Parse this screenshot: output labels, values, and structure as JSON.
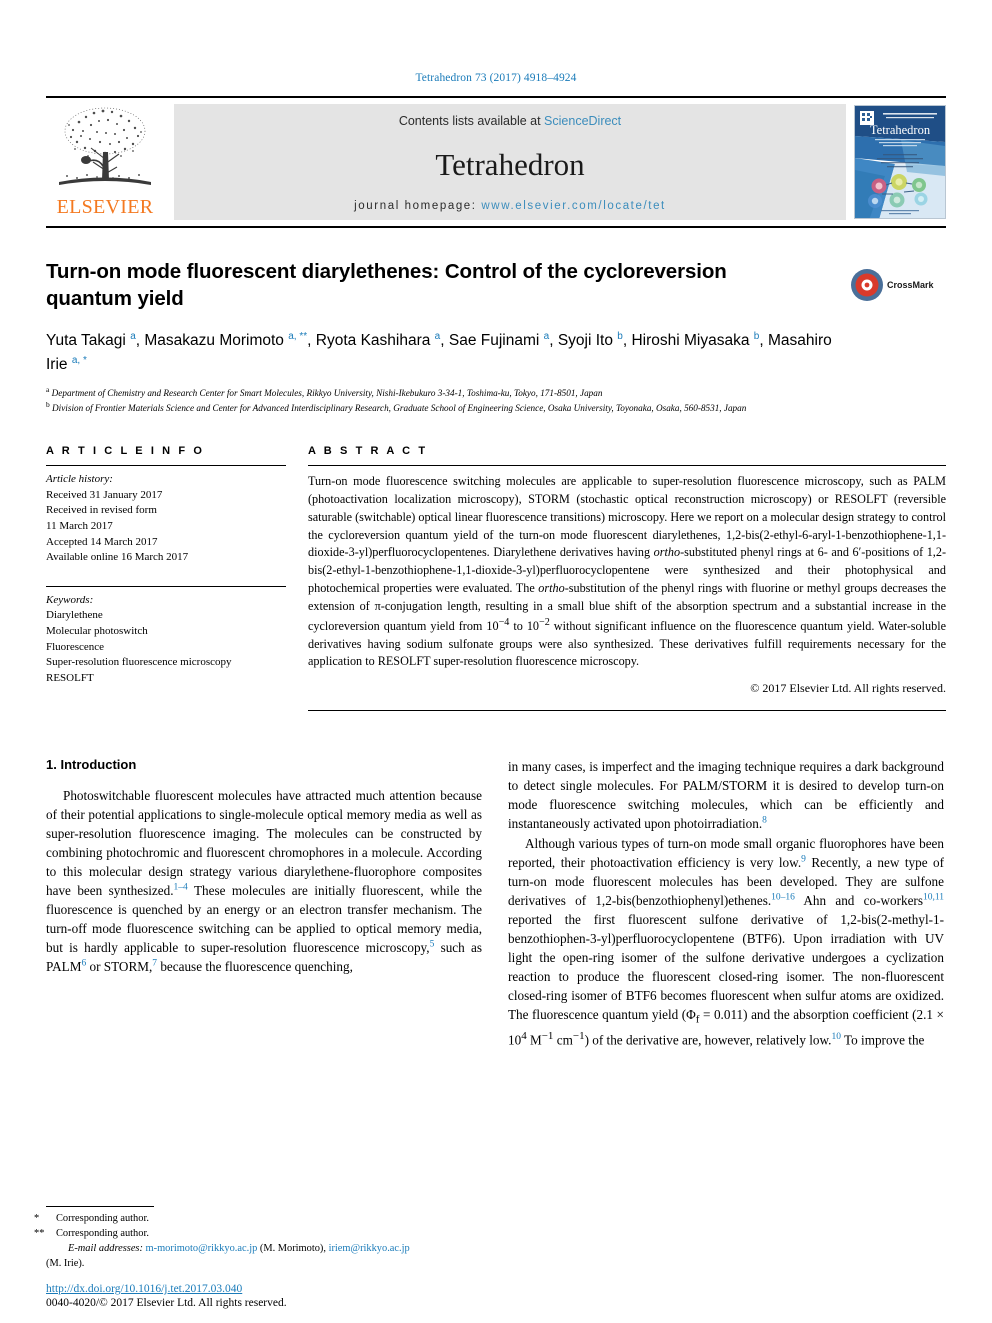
{
  "running_head": "Tetrahedron 73 (2017) 4918–4924",
  "masthead": {
    "publisher": "ELSEVIER",
    "contents_prefix": "Contents lists available at ",
    "contents_link": "ScienceDirect",
    "journal_name": "Tetrahedron",
    "homepage_prefix": "journal homepage: ",
    "homepage_url": "www.elsevier.com/locate/tet",
    "cover_title": "Tetrahedron"
  },
  "article": {
    "title": "Turn-on mode fluorescent diarylethenes: Control of the cycloreversion quantum yield",
    "crossmark_label": "CrossMark",
    "authors": [
      {
        "name": "Yuta Takagi",
        "marks": "a"
      },
      {
        "name": "Masakazu Morimoto",
        "marks": "a, **"
      },
      {
        "name": "Ryota Kashihara",
        "marks": "a"
      },
      {
        "name": "Sae Fujinami",
        "marks": "a"
      },
      {
        "name": "Syoji Ito",
        "marks": "b"
      },
      {
        "name": "Hiroshi Miyasaka",
        "marks": "b"
      },
      {
        "name": "Masahiro Irie",
        "marks": "a, *"
      }
    ],
    "affiliations": [
      {
        "mark": "a",
        "text": "Department of Chemistry and Research Center for Smart Molecules, Rikkyo University, Nishi-Ikebukuro 3-34-1, Toshima-ku, Tokyo, 171-8501, Japan"
      },
      {
        "mark": "b",
        "text": "Division of Frontier Materials Science and Center for Advanced Interdisciplinary Research, Graduate School of Engineering Science, Osaka University, Toyonaka, Osaka, 560-8531, Japan"
      }
    ]
  },
  "article_info": {
    "heading": "A R T I C L E   I N F O",
    "history_label": "Article history:",
    "history": [
      "Received 31 January 2017",
      "Received in revised form",
      "11 March 2017",
      "Accepted 14 March 2017",
      "Available online 16 March 2017"
    ],
    "keywords_label": "Keywords:",
    "keywords": [
      "Diarylethene",
      "Molecular photoswitch",
      "Fluorescence",
      "Super-resolution fluorescence microscopy",
      "RESOLFT"
    ]
  },
  "abstract": {
    "heading": "A B S T R A C T",
    "text_part1": "Turn-on mode fluorescence switching molecules are applicable to super-resolution fluorescence microscopy, such as PALM (photoactivation localization microscopy), STORM (stochastic optical reconstruction microscopy) or RESOLFT (reversible saturable (switchable) optical linear fluorescence transitions) microscopy. Here we report on a molecular design strategy to control the cycloreversion quantum yield of the turn-on mode fluorescent diarylethenes, 1,2-bis(2-ethyl-6-aryl-1-benzothiophene-1,1-dioxide-3-yl)perfluorocyclopentenes. Diarylethene derivatives having ",
    "ortho1": "ortho",
    "text_part2": "-substituted phenyl rings at 6- and 6′-positions of 1,2-bis(2-ethyl-1-benzothiophene-1,1-dioxide-3-yl)perfluorocyclopentene were synthesized and their photophysical and photochemical properties were evaluated. The ",
    "ortho2": "ortho",
    "text_part3": "-substitution of the phenyl rings with fluorine or methyl groups decreases the extension of π-conjugation length, resulting in a small blue shift of the absorption spectrum and a substantial increase in the cycloreversion quantum yield from 10",
    "exp1": "−4",
    "text_part4": " to 10",
    "exp2": "−2",
    "text_part5": " without significant influence on the fluorescence quantum yield. Water-soluble derivatives having sodium sulfonate groups were also synthesized. These derivatives fulfill requirements necessary for the application to RESOLFT super-resolution fluorescence microscopy.",
    "copyright": "© 2017 Elsevier Ltd. All rights reserved."
  },
  "body": {
    "section_heading": "1. Introduction",
    "left_p1_a": "Photoswitchable fluorescent molecules have attracted much attention because of their potential applications to single-molecule optical memory media as well as super-resolution fluorescence imaging. The molecules can be constructed by combining photochromic and fluorescent chromophores in a molecule. According to this molecular design strategy various diarylethene-fluorophore composites have been synthesized.",
    "left_ref1": "1–4",
    "left_p1_b": " These molecules are initially fluorescent, while the fluorescence is quenched by an energy or an electron transfer mechanism. The turn-off mode fluorescence switching can be applied to optical memory media, but is hardly applicable to super-resolution fluorescence microscopy,",
    "left_ref2": "5",
    "left_p1_c": " such as PALM",
    "left_ref3": "6",
    "left_p1_d": " or STORM,",
    "left_ref4": "7",
    "left_p1_e": " because the fluorescence quenching,",
    "right_p1_a": "in many cases, is imperfect and the imaging technique requires a dark background to detect single molecules. For PALM/STORM it is desired to develop turn-on mode fluorescence switching molecules, which can be efficiently and instantaneously activated upon photoirradiation.",
    "right_ref1": "8",
    "right_p2_a": "Although various types of turn-on mode small organic fluorophores have been reported, their photoactivation efficiency is very low.",
    "right_ref2": "9",
    "right_p2_b": " Recently, a new type of turn-on mode fluorescent molecules has been developed. They are sulfone derivatives of 1,2-bis(benzothiophenyl)ethenes.",
    "right_ref3": "10–16",
    "right_p2_c": " Ahn and co-workers",
    "right_ref4": "10,11",
    "right_p2_d": " reported the first fluorescent sulfone derivative of 1,2-bis(2-methyl-1-benzothiophen-3-yl)perfluorocyclopentene (BTF6). Upon irradiation with UV light the open-ring isomer of the sulfone derivative undergoes a cyclization reaction to produce the fluorescent closed-ring isomer. The non-fluorescent closed-ring isomer of BTF6 becomes fluorescent when sulfur atoms are oxidized. The fluorescence quantum yield (Φ",
    "right_sub1": "f",
    "right_p2_e": " = 0.011) and the absorption coefficient (2.1 × 10",
    "right_exp1": "4",
    "right_p2_f": " M",
    "right_exp2": "−1",
    "right_p2_g": " cm",
    "right_exp3": "−1",
    "right_p2_h": ") of the derivative are, however, relatively low.",
    "right_ref5": "10",
    "right_p2_i": " To improve the"
  },
  "footnotes": {
    "corr1": "Corresponding author.",
    "corr2": "Corresponding author.",
    "email_label": "E-mail addresses:",
    "email1": "m-morimoto@rikkyo.ac.jp",
    "email1_who": " (M. Morimoto), ",
    "email2": "iriem@rikkyo.ac.jp",
    "email2_who": "(M. Irie).",
    "doi": "http://dx.doi.org/10.1016/j.tet.2017.03.040",
    "issn": "0040-4020/© 2017 Elsevier Ltd. All rights reserved."
  },
  "colors": {
    "link": "#1a7bb9",
    "elsevier_orange": "#f47920",
    "masthead_gray": "#e4e4e4"
  }
}
